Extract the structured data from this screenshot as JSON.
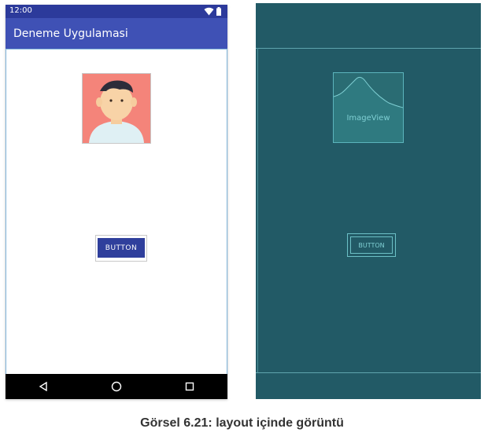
{
  "phone": {
    "status_bar": {
      "time": "12:00",
      "icons": [
        "wifi-icon",
        "battery-icon"
      ]
    },
    "app_bar": {
      "title": "Deneme Uygulamasi"
    },
    "image_view": {
      "content": "avatar-illustration"
    },
    "button": {
      "label": "BUTTON"
    },
    "nav_bar": {
      "icons": [
        "back-icon",
        "home-icon",
        "recents-icon"
      ]
    }
  },
  "blueprint": {
    "image_view_label": "ImageView",
    "button_label": "BUTTON"
  },
  "caption": "Görsel 6.21: layout içinde görüntü",
  "colors": {
    "status_bar": "#2c3a9b",
    "app_bar": "#3f51b5",
    "button": "#2f3f9c",
    "avatar_bg": "#f4847a",
    "blueprint_bg": "#225a66",
    "blueprint_lines": "#5fa4ae"
  }
}
